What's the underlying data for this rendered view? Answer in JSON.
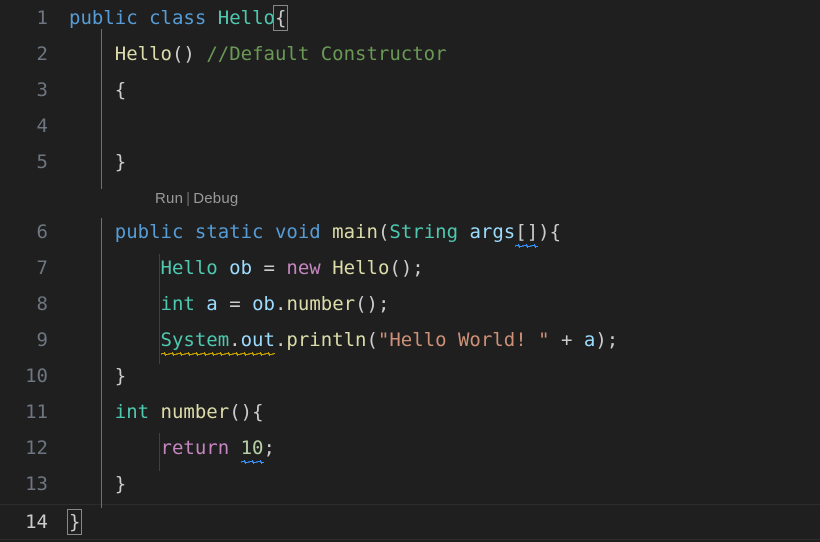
{
  "editor": {
    "theme": "dark-modern",
    "background": "#1f1f1f",
    "line_number_color": "#6e7681",
    "active_line_number_color": "#cccccc",
    "indent_guide_color": "#404040",
    "active_indent_guide_color": "#707070",
    "tab_size": 4,
    "language": "java",
    "total_lines": 14,
    "cursor_line": 14
  },
  "colors": {
    "keyword": "#569cd6",
    "control_keyword": "#c586c0",
    "type": "#4ec9b0",
    "function": "#dcdcaa",
    "variable": "#9cdcfe",
    "string": "#ce9178",
    "number": "#b5cea8",
    "comment": "#6a9955",
    "punctuation": "#cccccc",
    "squiggle_info": "#3794ff",
    "squiggle_warning": "#cca700",
    "bracket_match_border": "#888888"
  },
  "gutter": {
    "numbers": [
      "1",
      "2",
      "3",
      "4",
      "5",
      "6",
      "7",
      "8",
      "9",
      "10",
      "11",
      "12",
      "13",
      "14"
    ]
  },
  "codelens": {
    "run_label": "Run",
    "separator": "|",
    "debug_label": "Debug"
  },
  "code": {
    "line1": {
      "kw_public": "public",
      "kw_class": "class",
      "type_hello": "Hello",
      "brace": "{"
    },
    "line2": {
      "fn_hello": "Hello",
      "parens": "()",
      "comment": "//Default Constructor"
    },
    "line3": {
      "brace": "{"
    },
    "line4": {
      "text": ""
    },
    "line5": {
      "brace": "}"
    },
    "line6": {
      "kw_public": "public",
      "kw_static": "static",
      "kw_void": "void",
      "fn_main": "main",
      "paren_open": "(",
      "type_string": "String",
      "var_args": "args",
      "brackets": "[]",
      "paren_close": ")",
      "brace": "{"
    },
    "line7": {
      "type_hello": "Hello",
      "var_ob": "ob",
      "op_eq": "=",
      "kw_new": "new",
      "fn_hello": "Hello",
      "tail": "();"
    },
    "line8": {
      "type_int": "int",
      "var_a": "a",
      "op_eq": "=",
      "var_ob": "ob",
      "dot": ".",
      "fn_number": "number",
      "tail": "();"
    },
    "line9": {
      "type_system": "System",
      "dot1": ".",
      "var_out": "out",
      "dot2": ".",
      "fn_println": "println",
      "paren_open": "(",
      "string": "\"Hello World! \"",
      "op_plus": "+",
      "var_a": "a",
      "tail": ");"
    },
    "line10": {
      "brace": "}"
    },
    "line11": {
      "type_int": "int",
      "fn_number": "number",
      "tail": "(){"
    },
    "line12": {
      "kw_return": "return",
      "number": "10",
      "semi": ";"
    },
    "line13": {
      "brace": "}"
    },
    "line14": {
      "brace": "}"
    }
  }
}
